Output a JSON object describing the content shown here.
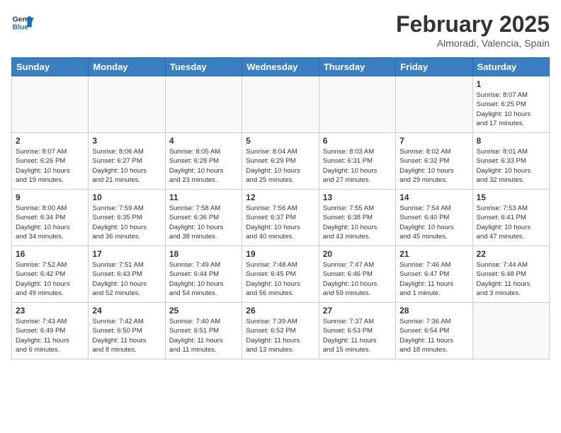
{
  "header": {
    "logo_line1": "General",
    "logo_line2": "Blue",
    "month_title": "February 2025",
    "location": "Almoradi, Valencia, Spain"
  },
  "weekdays": [
    "Sunday",
    "Monday",
    "Tuesday",
    "Wednesday",
    "Thursday",
    "Friday",
    "Saturday"
  ],
  "weeks": [
    [
      {
        "day": "",
        "info": ""
      },
      {
        "day": "",
        "info": ""
      },
      {
        "day": "",
        "info": ""
      },
      {
        "day": "",
        "info": ""
      },
      {
        "day": "",
        "info": ""
      },
      {
        "day": "",
        "info": ""
      },
      {
        "day": "1",
        "info": "Sunrise: 8:07 AM\nSunset: 6:25 PM\nDaylight: 10 hours\nand 17 minutes."
      }
    ],
    [
      {
        "day": "2",
        "info": "Sunrise: 8:07 AM\nSunset: 6:26 PM\nDaylight: 10 hours\nand 19 minutes."
      },
      {
        "day": "3",
        "info": "Sunrise: 8:06 AM\nSunset: 6:27 PM\nDaylight: 10 hours\nand 21 minutes."
      },
      {
        "day": "4",
        "info": "Sunrise: 8:05 AM\nSunset: 6:28 PM\nDaylight: 10 hours\nand 23 minutes."
      },
      {
        "day": "5",
        "info": "Sunrise: 8:04 AM\nSunset: 6:29 PM\nDaylight: 10 hours\nand 25 minutes."
      },
      {
        "day": "6",
        "info": "Sunrise: 8:03 AM\nSunset: 6:31 PM\nDaylight: 10 hours\nand 27 minutes."
      },
      {
        "day": "7",
        "info": "Sunrise: 8:02 AM\nSunset: 6:32 PM\nDaylight: 10 hours\nand 29 minutes."
      },
      {
        "day": "8",
        "info": "Sunrise: 8:01 AM\nSunset: 6:33 PM\nDaylight: 10 hours\nand 32 minutes."
      }
    ],
    [
      {
        "day": "9",
        "info": "Sunrise: 8:00 AM\nSunset: 6:34 PM\nDaylight: 10 hours\nand 34 minutes."
      },
      {
        "day": "10",
        "info": "Sunrise: 7:59 AM\nSunset: 6:35 PM\nDaylight: 10 hours\nand 36 minutes."
      },
      {
        "day": "11",
        "info": "Sunrise: 7:58 AM\nSunset: 6:36 PM\nDaylight: 10 hours\nand 38 minutes."
      },
      {
        "day": "12",
        "info": "Sunrise: 7:56 AM\nSunset: 6:37 PM\nDaylight: 10 hours\nand 40 minutes."
      },
      {
        "day": "13",
        "info": "Sunrise: 7:55 AM\nSunset: 6:38 PM\nDaylight: 10 hours\nand 43 minutes."
      },
      {
        "day": "14",
        "info": "Sunrise: 7:54 AM\nSunset: 6:40 PM\nDaylight: 10 hours\nand 45 minutes."
      },
      {
        "day": "15",
        "info": "Sunrise: 7:53 AM\nSunset: 6:41 PM\nDaylight: 10 hours\nand 47 minutes."
      }
    ],
    [
      {
        "day": "16",
        "info": "Sunrise: 7:52 AM\nSunset: 6:42 PM\nDaylight: 10 hours\nand 49 minutes."
      },
      {
        "day": "17",
        "info": "Sunrise: 7:51 AM\nSunset: 6:43 PM\nDaylight: 10 hours\nand 52 minutes."
      },
      {
        "day": "18",
        "info": "Sunrise: 7:49 AM\nSunset: 6:44 PM\nDaylight: 10 hours\nand 54 minutes."
      },
      {
        "day": "19",
        "info": "Sunrise: 7:48 AM\nSunset: 6:45 PM\nDaylight: 10 hours\nand 56 minutes."
      },
      {
        "day": "20",
        "info": "Sunrise: 7:47 AM\nSunset: 6:46 PM\nDaylight: 10 hours\nand 59 minutes."
      },
      {
        "day": "21",
        "info": "Sunrise: 7:46 AM\nSunset: 6:47 PM\nDaylight: 11 hours\nand 1 minute."
      },
      {
        "day": "22",
        "info": "Sunrise: 7:44 AM\nSunset: 6:48 PM\nDaylight: 11 hours\nand 3 minutes."
      }
    ],
    [
      {
        "day": "23",
        "info": "Sunrise: 7:43 AM\nSunset: 6:49 PM\nDaylight: 11 hours\nand 6 minutes."
      },
      {
        "day": "24",
        "info": "Sunrise: 7:42 AM\nSunset: 6:50 PM\nDaylight: 11 hours\nand 8 minutes."
      },
      {
        "day": "25",
        "info": "Sunrise: 7:40 AM\nSunset: 6:51 PM\nDaylight: 11 hours\nand 11 minutes."
      },
      {
        "day": "26",
        "info": "Sunrise: 7:39 AM\nSunset: 6:52 PM\nDaylight: 11 hours\nand 13 minutes."
      },
      {
        "day": "27",
        "info": "Sunrise: 7:37 AM\nSunset: 6:53 PM\nDaylight: 11 hours\nand 15 minutes."
      },
      {
        "day": "28",
        "info": "Sunrise: 7:36 AM\nSunset: 6:54 PM\nDaylight: 11 hours\nand 18 minutes."
      },
      {
        "day": "",
        "info": ""
      }
    ]
  ]
}
